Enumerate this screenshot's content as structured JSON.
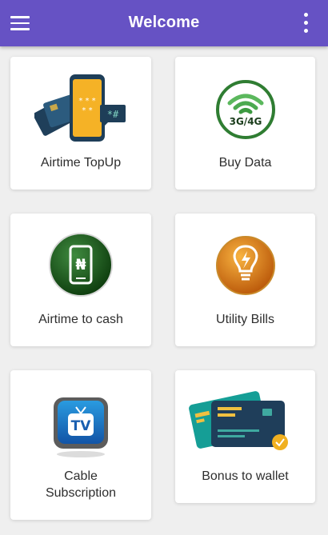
{
  "header": {
    "title": "Welcome",
    "menu_icon": "hamburger-menu-icon",
    "overflow_icon": "more-vertical-icon",
    "bar_color": "#6652c4"
  },
  "services": [
    {
      "label": "Airtime TopUp",
      "icon": "phone-card-icon"
    },
    {
      "label": "Buy Data",
      "icon": "wifi-3g-4g-icon"
    },
    {
      "label": "Airtime to cash",
      "icon": "naira-phone-icon"
    },
    {
      "label": "Utility Bills",
      "icon": "lightbulb-icon"
    },
    {
      "label_line1": "Cable",
      "label_line2": "Subscription",
      "icon": "tv-icon"
    },
    {
      "label": "Bonus to wallet",
      "icon": "credit-card-icon"
    }
  ],
  "icon_text": {
    "data_badge": "3G/4G",
    "keypad_code": "*#",
    "tv_badge": "TV"
  }
}
